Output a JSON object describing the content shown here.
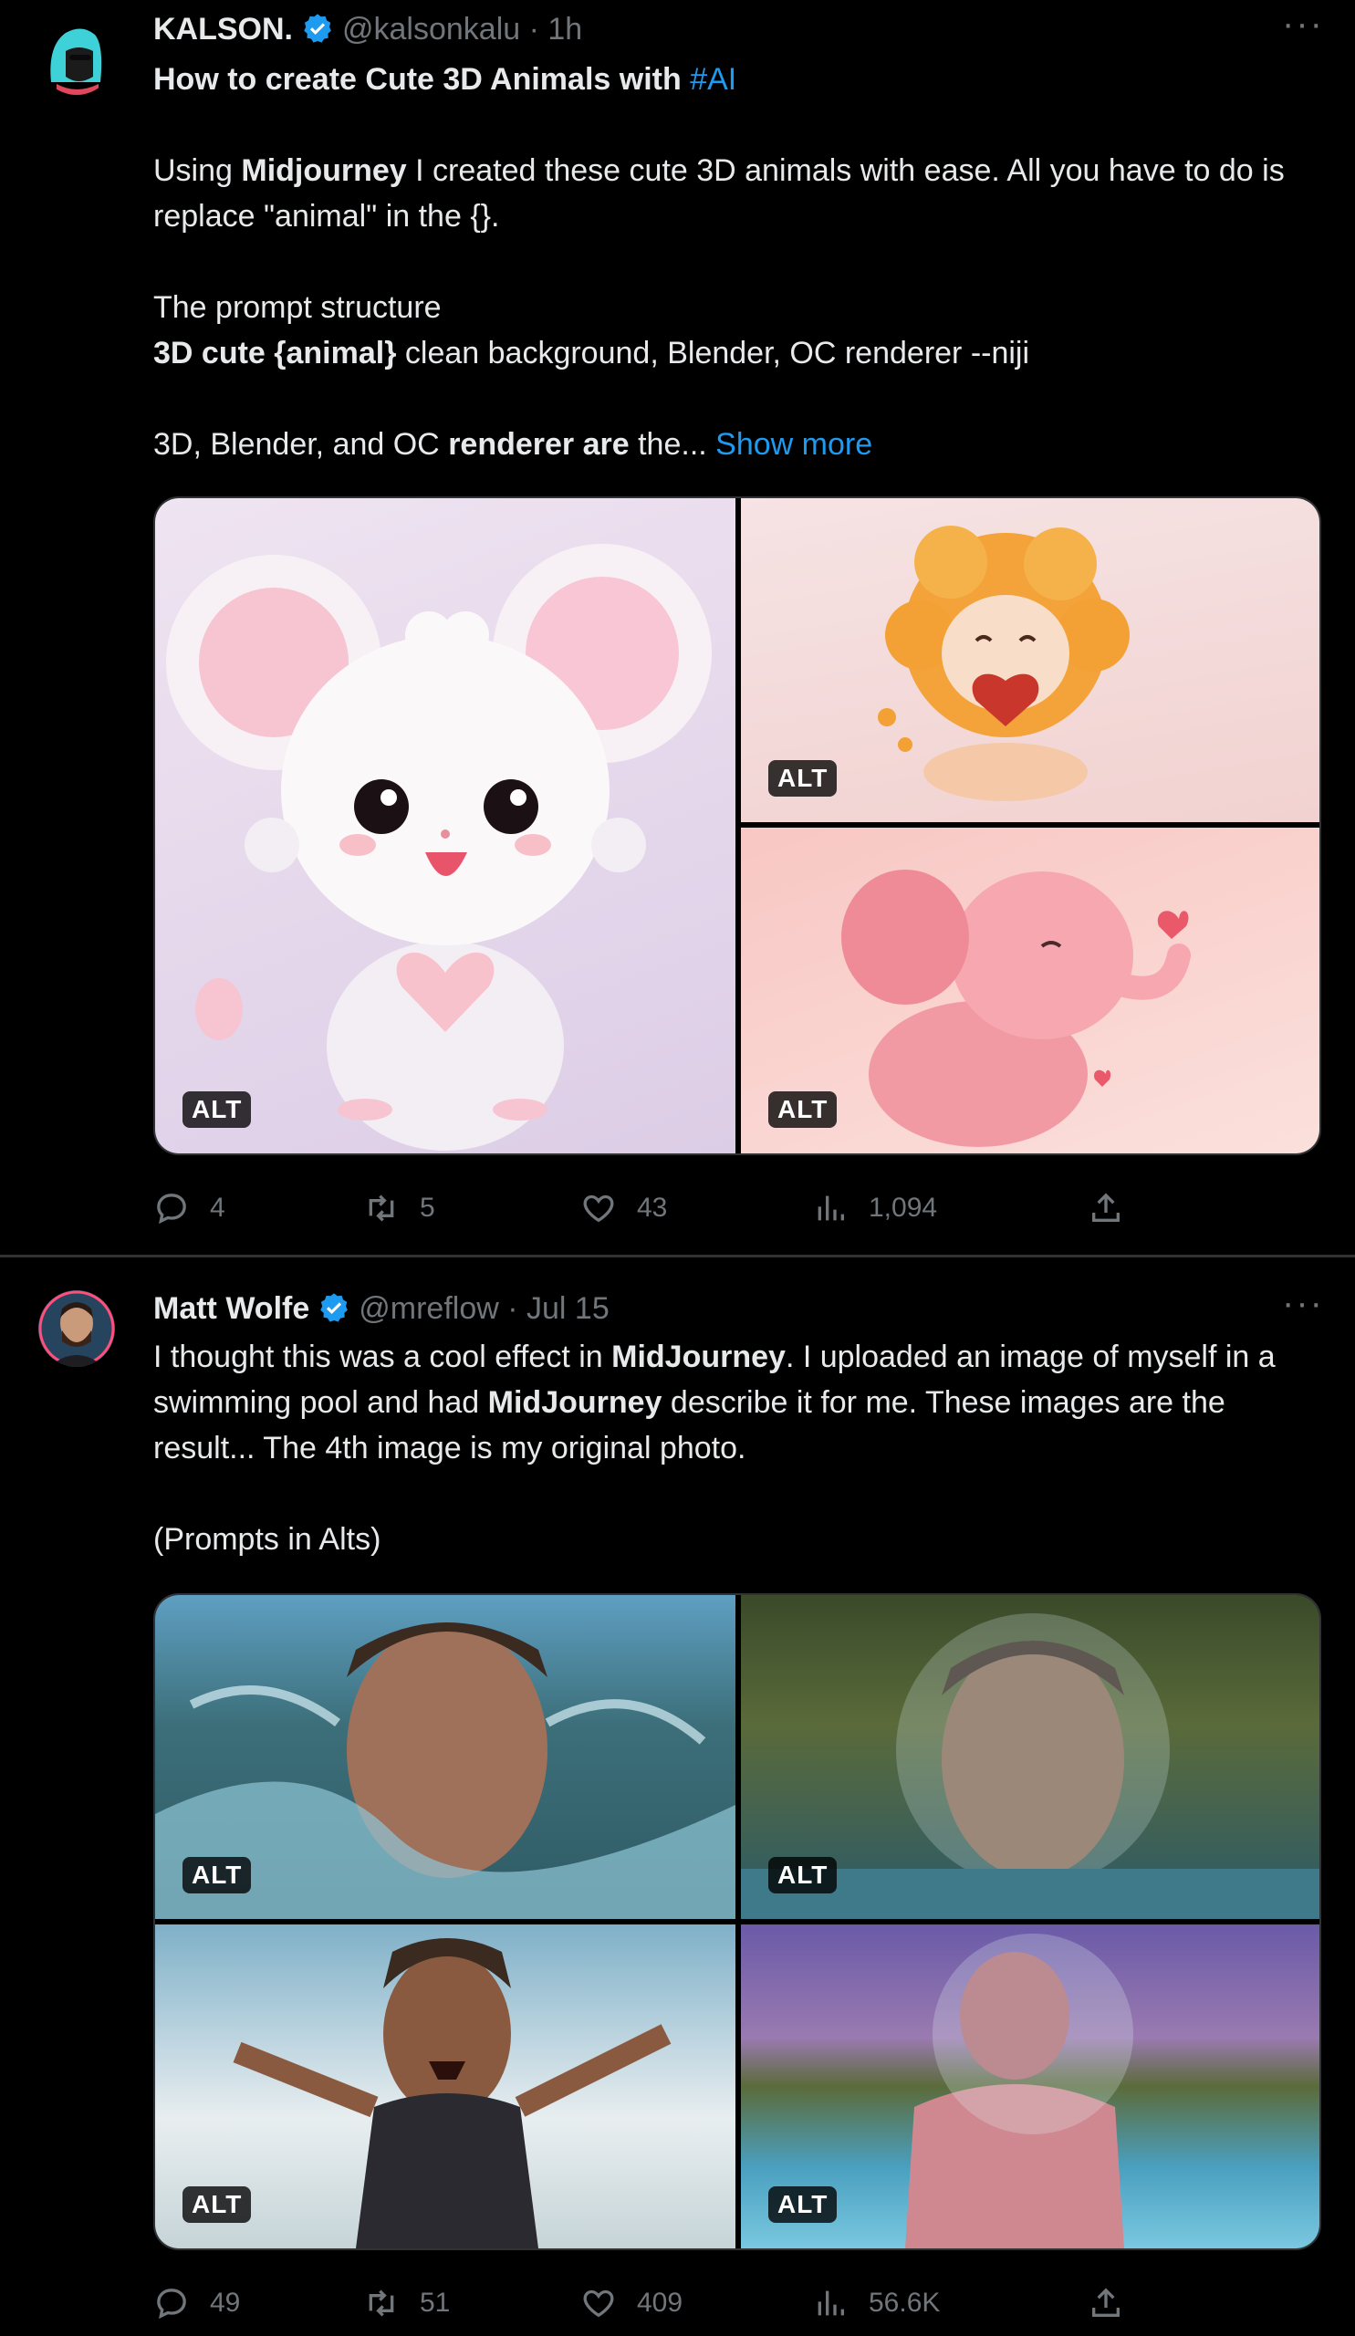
{
  "tweets": [
    {
      "name": "KALSON.",
      "handle": "@kalsonkalu · 1h",
      "more": "···",
      "line1_bold": "How to create Cute 3D Animals with ",
      "line1_link": "#AI",
      "p2_a": "Using ",
      "p2_bold": "Midjourney",
      "p2_b": " I created these cute 3D animals with ease. All you have to do is replace \"animal\" in the {}.",
      "p3_line1": "The prompt structure",
      "p3_bold": "3D cute {animal}",
      "p3_rest": " clean background, Blender, OC renderer --niji",
      "p4_a": "3D, Blender, and OC ",
      "p4_bold": "renderer are",
      "p4_b": " the... ",
      "show_more": "Show more",
      "alt_label": "ALT",
      "replies": "4",
      "retweets": "5",
      "likes": "43",
      "views": "1,094"
    },
    {
      "name": "Matt Wolfe",
      "handle": "@mreflow · Jul 15",
      "more": "···",
      "p1_a": "I thought this was a cool effect in ",
      "p1_bold1": "MidJourney",
      "p1_b": ". I uploaded an image of myself in a swimming pool and had ",
      "p1_bold2": "MidJourney",
      "p1_c": " describe it for me. These images are the result... The 4th image is my original photo.",
      "p2": "(Prompts in Alts)",
      "alt_label": "ALT",
      "replies": "49",
      "retweets": "51",
      "likes": "409",
      "views": "56.6K"
    }
  ],
  "colors": {
    "background": "#000000",
    "text": "#e7e9ea",
    "muted": "#71767b",
    "link": "#1d9bf0",
    "verified": "#1d9bf0"
  },
  "icons": [
    "verified-badge-icon",
    "more-icon",
    "reply-icon",
    "retweet-icon",
    "like-icon",
    "views-icon",
    "share-icon"
  ]
}
